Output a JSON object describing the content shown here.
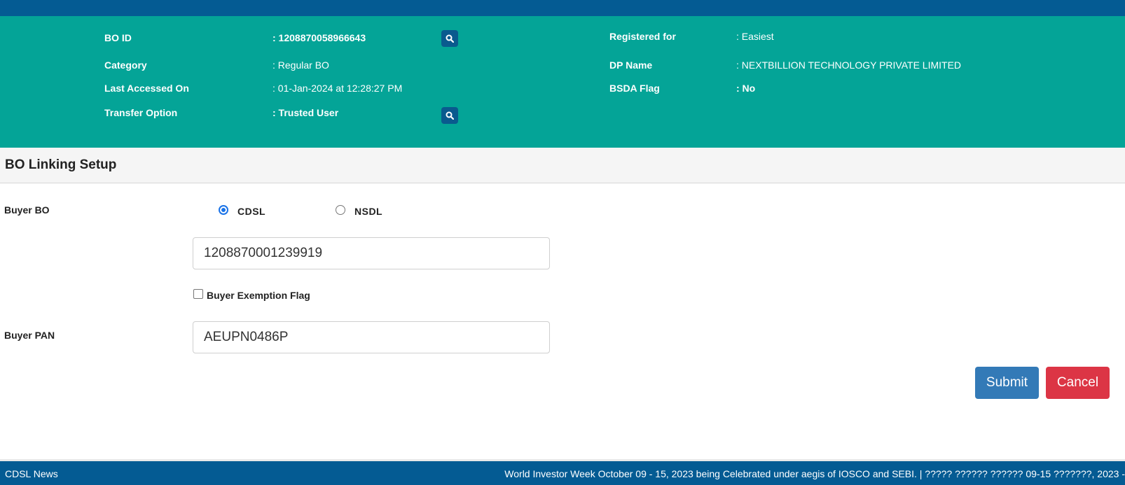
{
  "bo_info": {
    "bo_id_label": "BO ID",
    "bo_id_value": ": 1208870058966643",
    "category_label": "Category",
    "category_value": ": Regular BO",
    "last_accessed_label": "Last Accessed On",
    "last_accessed_value": ": 01-Jan-2024 at 12:28:27 PM",
    "transfer_option_label": "Transfer Option",
    "transfer_option_value": ": Trusted User",
    "registered_for_label": "Registered for",
    "registered_for_value": ": Easiest",
    "dp_name_label": "DP Name",
    "dp_name_value": ": NEXTBILLION TECHNOLOGY PRIVATE LIMITED",
    "bsda_flag_label": "BSDA Flag",
    "bsda_flag_value": ": No"
  },
  "section": {
    "title": "BO Linking Setup"
  },
  "form": {
    "buyer_bo_label": "Buyer BO",
    "radio_cdsl_label": "CDSL",
    "radio_nsdl_label": "NSDL",
    "selected_depository": "CDSL",
    "buyer_bo_value": "1208870001239919",
    "exemption_label": "Buyer Exemption Flag",
    "exemption_checked": false,
    "buyer_pan_label": "Buyer PAN",
    "buyer_pan_value": "AEUPN0486P"
  },
  "buttons": {
    "submit": "Submit",
    "cancel": "Cancel"
  },
  "footer": {
    "news_label": "CDSL News",
    "ticker_text": "World Investor Week October 09 - 15, 2023 being Celebrated under aegis of IOSCO and SEBI. | ????? ?????? ?????? 09-15 ???????, 2023 -"
  },
  "colors": {
    "header_blue": "#045b93",
    "panel_teal": "#04a497",
    "submit_blue": "#337ab7",
    "cancel_red": "#dc3545"
  },
  "icons": {
    "search": "search-icon"
  }
}
